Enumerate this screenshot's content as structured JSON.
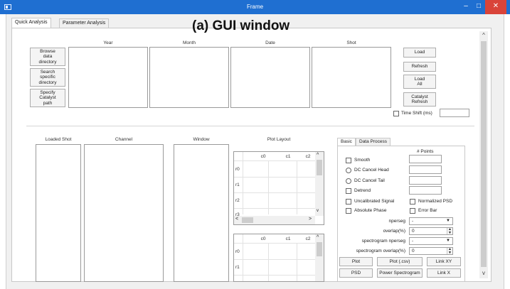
{
  "window": {
    "title": "Frame",
    "min": "–",
    "max": "□",
    "close": "✕"
  },
  "overlay_label": "(a) GUI window",
  "tabs": [
    "Quick Analysis",
    "Parameter Analysis"
  ],
  "top_section": {
    "columns": [
      "Year",
      "Month",
      "Date",
      "Shot"
    ],
    "left_buttons": [
      "Browse\ndata\ndirectory",
      "Search\nspecific\ndirectory",
      "Specify\nCatalyst\npath"
    ],
    "right_buttons": [
      "Load",
      "Refresh",
      "Load\nAll",
      "Catalyst\nRefresh"
    ],
    "time_shift_label": "Time Shift (ms)",
    "time_shift_value": ""
  },
  "bottom_section": {
    "columns": [
      "Loaded Shot",
      "Channel",
      "Window",
      "Plot Layout"
    ],
    "grid1": {
      "cols": [
        "c0",
        "c1",
        "c2"
      ],
      "rows": [
        "r0",
        "r1",
        "r2",
        "r3"
      ]
    },
    "grid2": {
      "cols": [
        "c0",
        "c1",
        "c2"
      ],
      "rows": [
        "r0",
        "r1"
      ]
    }
  },
  "process_panel": {
    "tabs": [
      "Basic",
      "Data Process"
    ],
    "points_header": "# Points",
    "options": [
      {
        "type": "checkbox",
        "label": "Smooth"
      },
      {
        "type": "radio",
        "label": "DC Cancel Head"
      },
      {
        "type": "radio",
        "label": "DC Cancel Tail"
      },
      {
        "type": "checkbox",
        "label": "Detrend"
      }
    ],
    "uncalibrated_signal": "Uncalibrated Signal",
    "normalized_psd": "Normalized PSD",
    "absolute_phase": "Absolute Phase",
    "error_bar": "Error Bar",
    "nperseg_label": "nperseg",
    "nperseg_value": "-",
    "overlap_label": "overlap(%)",
    "overlap_value": "0",
    "spec_nperseg_label": "spectrogram nperseg",
    "spec_nperseg_value": "-",
    "spec_overlap_label": "spectrogram overlap(%)",
    "spec_overlap_value": "0",
    "buttons_row1": [
      "Plot",
      "Plot (.csv)",
      "Link XY"
    ],
    "buttons_row2": [
      "PSD",
      "Power Spectrogram",
      "Link X"
    ]
  }
}
